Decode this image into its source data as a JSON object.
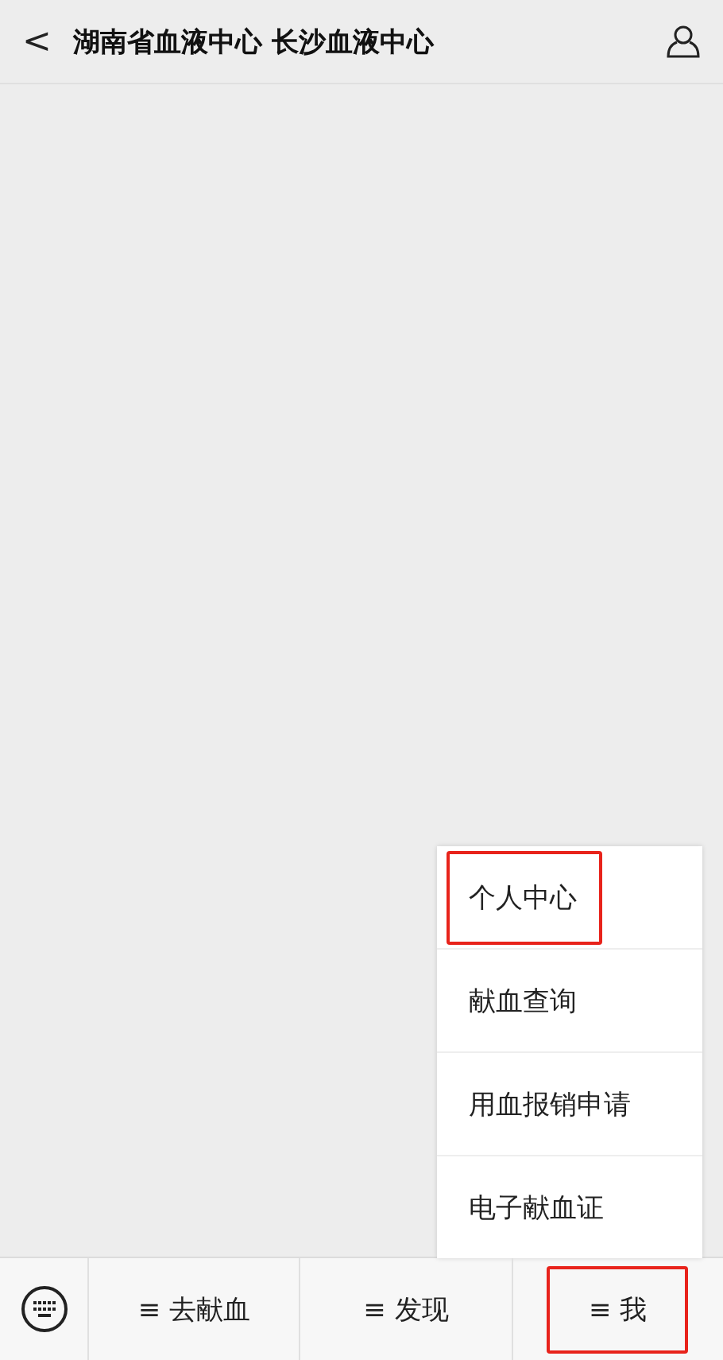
{
  "header": {
    "back": "<",
    "title": "湖南省血液中心 长沙血液中心"
  },
  "menu": {
    "items": [
      {
        "label": "个人中心",
        "highlighted": true
      },
      {
        "label": "献血查询",
        "highlighted": false
      },
      {
        "label": "用血报销申请",
        "highlighted": false
      },
      {
        "label": "电子献血证",
        "highlighted": false
      }
    ]
  },
  "tabs": [
    {
      "icon": "≡",
      "label": "去献血",
      "highlighted": false
    },
    {
      "icon": "≡",
      "label": "发现",
      "highlighted": false
    },
    {
      "icon": "≡",
      "label": "我",
      "highlighted": true
    }
  ]
}
